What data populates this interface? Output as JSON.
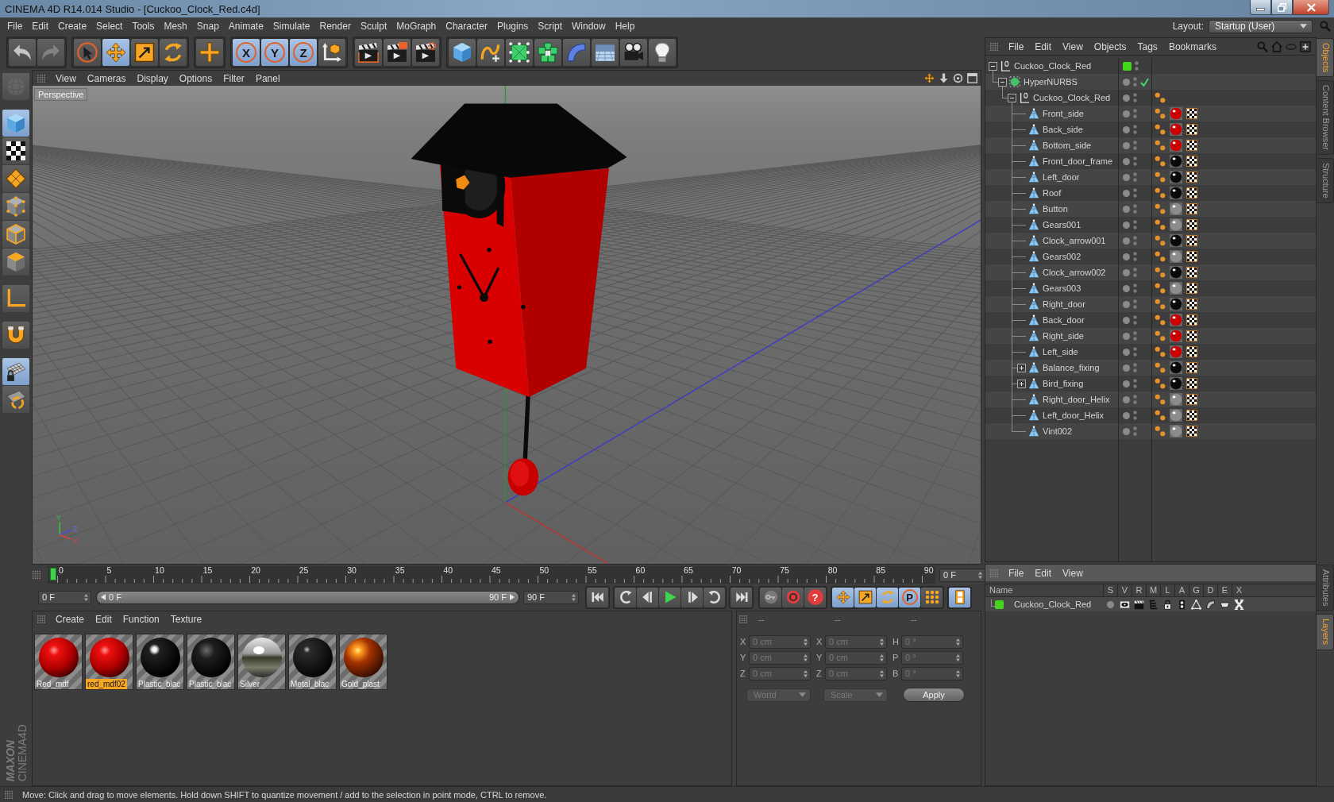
{
  "window": {
    "title": "CINEMA 4D R14.014 Studio - [Cuckoo_Clock_Red.c4d]"
  },
  "menu_bar": {
    "items": [
      "File",
      "Edit",
      "Create",
      "Select",
      "Tools",
      "Mesh",
      "Snap",
      "Animate",
      "Simulate",
      "Render",
      "Sculpt",
      "MoGraph",
      "Character",
      "Plugins",
      "Script",
      "Window",
      "Help"
    ],
    "layout_label": "Layout:",
    "layout_value": "Startup (User)"
  },
  "main_toolbar": [
    {
      "selected": false,
      "disabled": false
    },
    {
      "selected": false,
      "disabled": true
    },
    {
      "selected": false,
      "disabled": false
    },
    {
      "selected": true,
      "disabled": false
    },
    {
      "selected": false,
      "disabled": false
    },
    {
      "selected": false,
      "disabled": false
    },
    {
      "selected": false,
      "disabled": false
    },
    {
      "label": "X",
      "selected": true,
      "disabled": false
    },
    {
      "label": "Y",
      "selected": true,
      "disabled": false
    },
    {
      "label": "Z",
      "selected": true,
      "disabled": false
    },
    {
      "selected": false,
      "disabled": false
    },
    {
      "selected": false,
      "disabled": false
    },
    {
      "selected": false,
      "disabled": false
    },
    {
      "selected": false,
      "disabled": false
    },
    {
      "selected": false,
      "disabled": false
    },
    {
      "selected": false,
      "disabled": false
    },
    {
      "selected": false,
      "disabled": false
    },
    {
      "selected": false,
      "disabled": false
    },
    {
      "selected": false,
      "disabled": false
    },
    {
      "selected": false,
      "disabled": false
    },
    {
      "selected": false,
      "disabled": false
    },
    {
      "selected": false,
      "disabled": false
    }
  ],
  "left_toolbar": [
    {
      "selected": false,
      "disabled": true
    },
    {
      "selected": true,
      "disabled": false
    },
    {
      "selected": false,
      "disabled": false
    },
    {
      "selected": false,
      "disabled": false
    },
    {
      "selected": false,
      "disabled": false
    },
    {
      "selected": false,
      "disabled": false
    },
    {
      "selected": false,
      "disabled": false
    },
    {
      "selected": false,
      "disabled": false
    },
    {
      "selected": false,
      "disabled": false
    },
    {
      "selected": true,
      "disabled": false
    },
    {
      "selected": false,
      "disabled": false
    }
  ],
  "viewport": {
    "menu": [
      "View",
      "Cameras",
      "Display",
      "Options",
      "Filter",
      "Panel"
    ],
    "camera": "Perspective",
    "gizmo_labels": [
      "Y",
      "Z",
      "X"
    ]
  },
  "timeline": {
    "ticks": [
      "0",
      "5",
      "10",
      "15",
      "20",
      "25",
      "30",
      "35",
      "40",
      "45",
      "50",
      "55",
      "60",
      "65",
      "70",
      "75",
      "80",
      "85",
      "90"
    ],
    "level": 0,
    "frame_field": "0 F"
  },
  "transport": {
    "start_field": "0 F",
    "range_slider": {
      "start_label": "0 F",
      "end_label": "90 F",
      "level": 1
    },
    "end_field": "90 F",
    "autokey_label": "?",
    "key_filters": [
      {
        "selected": true
      },
      {
        "selected": true
      },
      {
        "selected": true
      },
      {
        "label": "P",
        "selected": true
      },
      {
        "selected": false
      }
    ],
    "timeline_button": {
      "selected": true
    }
  },
  "material_manager": {
    "menu": [
      "Create",
      "Edit",
      "Function",
      "Texture"
    ],
    "materials": [
      {
        "name": "Red_mdf",
        "kind": "red",
        "selected": false
      },
      {
        "name": "red_mdf02",
        "kind": "red",
        "selected": true
      },
      {
        "name": "Plastic_blac",
        "kind": "gloss",
        "selected": false
      },
      {
        "name": "Plastic_blac",
        "kind": "matte",
        "selected": false
      },
      {
        "name": "Silver",
        "kind": "chrome",
        "selected": false
      },
      {
        "name": "Metal_blac",
        "kind": "metal",
        "selected": false
      },
      {
        "name": "Gold_plast",
        "kind": "gold",
        "selected": false
      }
    ]
  },
  "coordinates": {
    "headers": [
      "--",
      "--",
      "--"
    ],
    "disabled": true,
    "rows": [
      {
        "cells": [
          {
            "axis": "X",
            "value": "0 cm"
          },
          {
            "axis": "X",
            "value": "0 cm"
          },
          {
            "axis": "H",
            "value": "0 °"
          }
        ]
      },
      {
        "cells": [
          {
            "axis": "Y",
            "value": "0 cm"
          },
          {
            "axis": "Y",
            "value": "0 cm"
          },
          {
            "axis": "P",
            "value": "0 °"
          }
        ]
      },
      {
        "cells": [
          {
            "axis": "Z",
            "value": "0 cm"
          },
          {
            "axis": "Z",
            "value": "0 cm"
          },
          {
            "axis": "B",
            "value": "0 °"
          }
        ]
      }
    ],
    "mode": "World",
    "transform": "Scale",
    "apply": "Apply"
  },
  "object_manager": {
    "menu": [
      "File",
      "Edit",
      "View",
      "Objects",
      "Tags",
      "Bookmarks"
    ],
    "objects": [
      {
        "name": "Cuckoo_Clock_Red",
        "kind": "null",
        "color": "#44d41c",
        "expanded": true,
        "children": [
          {
            "name": "HyperNURBS",
            "kind": "nurbs",
            "enabled": true,
            "expanded": true,
            "children": [
              {
                "name": "Cuckoo_Clock_Red",
                "kind": "null",
                "expanded": true,
                "tags": [
                  {
                    "kind": "phong"
                  }
                ],
                "children": [
                  {
                    "name": "Front_side",
                    "kind": "polygon",
                    "tags": [
                      {
                        "kind": "phong"
                      },
                      {
                        "kind": "material",
                        "color": "#cc0000"
                      },
                      {
                        "kind": "texture"
                      }
                    ]
                  },
                  {
                    "name": "Back_side",
                    "kind": "polygon",
                    "tags": [
                      {
                        "kind": "phong"
                      },
                      {
                        "kind": "material",
                        "color": "#cc0000"
                      },
                      {
                        "kind": "texture"
                      }
                    ]
                  },
                  {
                    "name": "Bottom_side",
                    "kind": "polygon",
                    "tags": [
                      {
                        "kind": "phong"
                      },
                      {
                        "kind": "material",
                        "color": "#cc0000"
                      },
                      {
                        "kind": "texture"
                      }
                    ]
                  },
                  {
                    "name": "Front_door_frame",
                    "kind": "polygon",
                    "tags": [
                      {
                        "kind": "phong"
                      },
                      {
                        "kind": "material",
                        "color": "#0a0a0a"
                      },
                      {
                        "kind": "texture"
                      }
                    ]
                  },
                  {
                    "name": "Left_door",
                    "kind": "polygon",
                    "tags": [
                      {
                        "kind": "phong"
                      },
                      {
                        "kind": "material",
                        "color": "#0a0a0a"
                      },
                      {
                        "kind": "texture"
                      }
                    ]
                  },
                  {
                    "name": "Roof",
                    "kind": "polygon",
                    "tags": [
                      {
                        "kind": "phong"
                      },
                      {
                        "kind": "material",
                        "color": "#0a0a0a"
                      },
                      {
                        "kind": "texture"
                      }
                    ]
                  },
                  {
                    "name": "Button",
                    "kind": "polygon",
                    "tags": [
                      {
                        "kind": "phong"
                      },
                      {
                        "kind": "material",
                        "color": "#8c8c8c"
                      },
                      {
                        "kind": "texture"
                      }
                    ]
                  },
                  {
                    "name": "Gears001",
                    "kind": "polygon",
                    "tags": [
                      {
                        "kind": "phong"
                      },
                      {
                        "kind": "material",
                        "color": "#8c8c8c"
                      },
                      {
                        "kind": "texture"
                      }
                    ]
                  },
                  {
                    "name": "Clock_arrow001",
                    "kind": "polygon",
                    "tags": [
                      {
                        "kind": "phong"
                      },
                      {
                        "kind": "material",
                        "color": "#0a0a0a"
                      },
                      {
                        "kind": "texture"
                      }
                    ]
                  },
                  {
                    "name": "Gears002",
                    "kind": "polygon",
                    "tags": [
                      {
                        "kind": "phong"
                      },
                      {
                        "kind": "material",
                        "color": "#8c8c8c"
                      },
                      {
                        "kind": "texture"
                      }
                    ]
                  },
                  {
                    "name": "Clock_arrow002",
                    "kind": "polygon",
                    "tags": [
                      {
                        "kind": "phong"
                      },
                      {
                        "kind": "material",
                        "color": "#0a0a0a"
                      },
                      {
                        "kind": "texture"
                      }
                    ]
                  },
                  {
                    "name": "Gears003",
                    "kind": "polygon",
                    "tags": [
                      {
                        "kind": "phong"
                      },
                      {
                        "kind": "material",
                        "color": "#8c8c8c"
                      },
                      {
                        "kind": "texture"
                      }
                    ]
                  },
                  {
                    "name": "Right_door",
                    "kind": "polygon",
                    "tags": [
                      {
                        "kind": "phong"
                      },
                      {
                        "kind": "material",
                        "color": "#0a0a0a"
                      },
                      {
                        "kind": "texture"
                      }
                    ]
                  },
                  {
                    "name": "Back_door",
                    "kind": "polygon",
                    "tags": [
                      {
                        "kind": "phong"
                      },
                      {
                        "kind": "material",
                        "color": "#cc0000"
                      },
                      {
                        "kind": "texture"
                      }
                    ]
                  },
                  {
                    "name": "Right_side",
                    "kind": "polygon",
                    "tags": [
                      {
                        "kind": "phong"
                      },
                      {
                        "kind": "material",
                        "color": "#cc0000"
                      },
                      {
                        "kind": "texture"
                      }
                    ]
                  },
                  {
                    "name": "Left_side",
                    "kind": "polygon",
                    "tags": [
                      {
                        "kind": "phong"
                      },
                      {
                        "kind": "material",
                        "color": "#cc0000"
                      },
                      {
                        "kind": "texture"
                      }
                    ]
                  },
                  {
                    "name": "Balance_fixing",
                    "kind": "polygon",
                    "expanded": false,
                    "tags": [
                      {
                        "kind": "phong"
                      },
                      {
                        "kind": "material",
                        "color": "#0a0a0a"
                      },
                      {
                        "kind": "texture"
                      }
                    ]
                  },
                  {
                    "name": "Bird_fixing",
                    "kind": "polygon",
                    "expanded": false,
                    "tags": [
                      {
                        "kind": "phong"
                      },
                      {
                        "kind": "material",
                        "color": "#0a0a0a"
                      },
                      {
                        "kind": "texture"
                      }
                    ]
                  },
                  {
                    "name": "Right_door_Helix",
                    "kind": "polygon",
                    "tags": [
                      {
                        "kind": "phong"
                      },
                      {
                        "kind": "material",
                        "color": "#8c8c8c"
                      },
                      {
                        "kind": "texture"
                      }
                    ]
                  },
                  {
                    "name": "Left_door_Helix",
                    "kind": "polygon",
                    "tags": [
                      {
                        "kind": "phong"
                      },
                      {
                        "kind": "material",
                        "color": "#8c8c8c"
                      },
                      {
                        "kind": "texture"
                      }
                    ]
                  },
                  {
                    "name": "Vint002",
                    "kind": "polygon",
                    "tags": [
                      {
                        "kind": "phong"
                      },
                      {
                        "kind": "material",
                        "color": "#8c8c8c"
                      },
                      {
                        "kind": "texture"
                      }
                    ]
                  }
                ]
              }
            ]
          }
        ]
      }
    ]
  },
  "object_tabs": [
    {
      "label": "Objects",
      "selected": true
    },
    {
      "label": "Content Browser",
      "selected": false
    },
    {
      "label": "Structure",
      "selected": false
    }
  ],
  "layer_manager": {
    "menu": [
      "File",
      "Edit",
      "View"
    ],
    "columns": [
      "Name",
      "S",
      "V",
      "R",
      "M",
      "L",
      "A",
      "G",
      "D",
      "E",
      "X"
    ],
    "layers": [
      {
        "name": "Cuckoo_Clock_Red",
        "color": "#44d41c"
      }
    ]
  },
  "layer_tabs": [
    {
      "label": "Attributes",
      "selected": false
    },
    {
      "label": "Layers",
      "selected": true
    }
  ],
  "logo": {
    "brand": "MAXON",
    "product": "CINEMA4D"
  },
  "status_bar": {
    "text": "Move: Click and drag to move elements. Hold down SHIFT to quantize movement / add to the selection in point mode, CTRL to remove."
  }
}
